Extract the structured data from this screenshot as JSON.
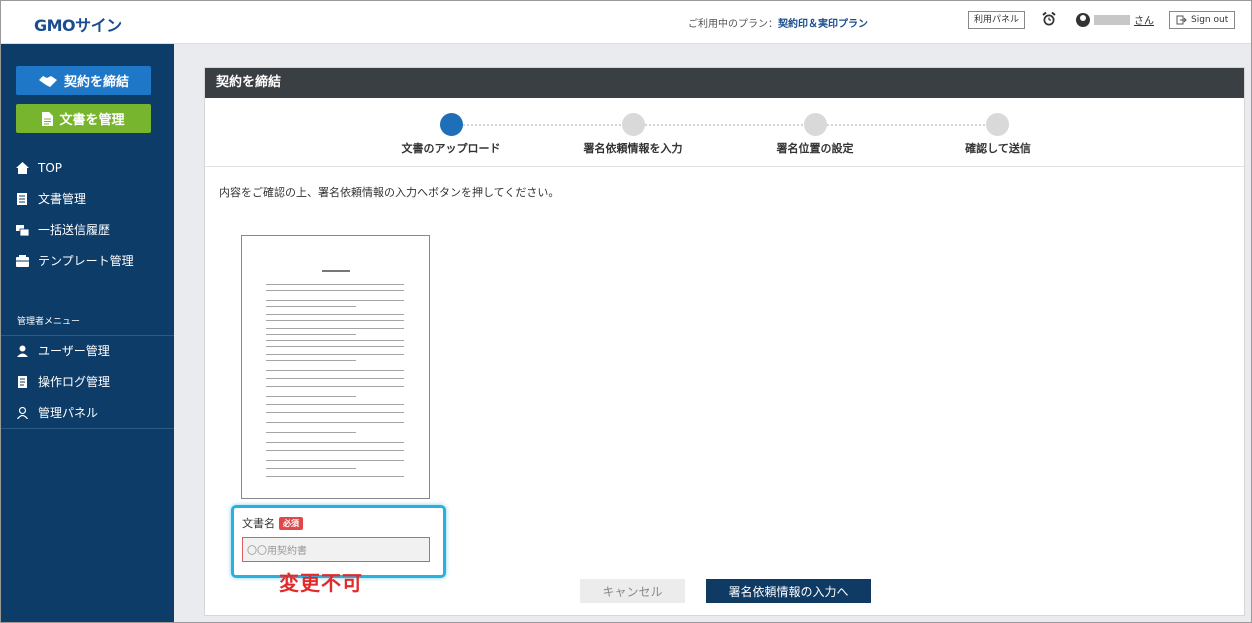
{
  "header": {
    "logo": "GMOサイン",
    "plan_prefix": "ご利用中のプラン：",
    "plan_name": "契約印＆実印プラン",
    "panel_button": "利用パネル",
    "user_suffix": "さん",
    "signout_label": "Sign out"
  },
  "sidebar": {
    "contract_button": "契約を締結",
    "manage_button": "文書を管理",
    "items": [
      {
        "label": "TOP",
        "icon": "home-icon"
      },
      {
        "label": "文書管理",
        "icon": "document-list-icon"
      },
      {
        "label": "一括送信履歴",
        "icon": "bulk-send-icon"
      },
      {
        "label": "テンプレート管理",
        "icon": "template-icon"
      }
    ],
    "admin_title": "管理者メニュー",
    "admin_items": [
      {
        "label": "ユーザー管理",
        "icon": "user-icon"
      },
      {
        "label": "操作ログ管理",
        "icon": "log-icon"
      },
      {
        "label": "管理パネル",
        "icon": "admin-panel-icon"
      }
    ]
  },
  "main": {
    "title": "契約を締結",
    "steps": [
      {
        "label": "文書のアップロード",
        "active": true
      },
      {
        "label": "署名依頼情報を入力",
        "active": false
      },
      {
        "label": "署名位置の設定",
        "active": false
      },
      {
        "label": "確認して送信",
        "active": false
      }
    ],
    "instruction": "内容をご確認の上、署名依頼情報の入力へボタンを押してください。",
    "doc_name_label": "文書名",
    "required_badge": "必須",
    "doc_name_value": "〇〇用契約書",
    "annotation": "変更不可",
    "cancel_button": "キャンセル",
    "next_button": "署名依頼情報の入力へ"
  },
  "colors": {
    "sidebar_bg": "#0e3c68",
    "contract_btn": "#1f77c8",
    "manage_btn": "#78b52e",
    "active_step": "#1e6fb8",
    "highlight": "#2ab0e0",
    "annotation": "#e22a2a"
  }
}
